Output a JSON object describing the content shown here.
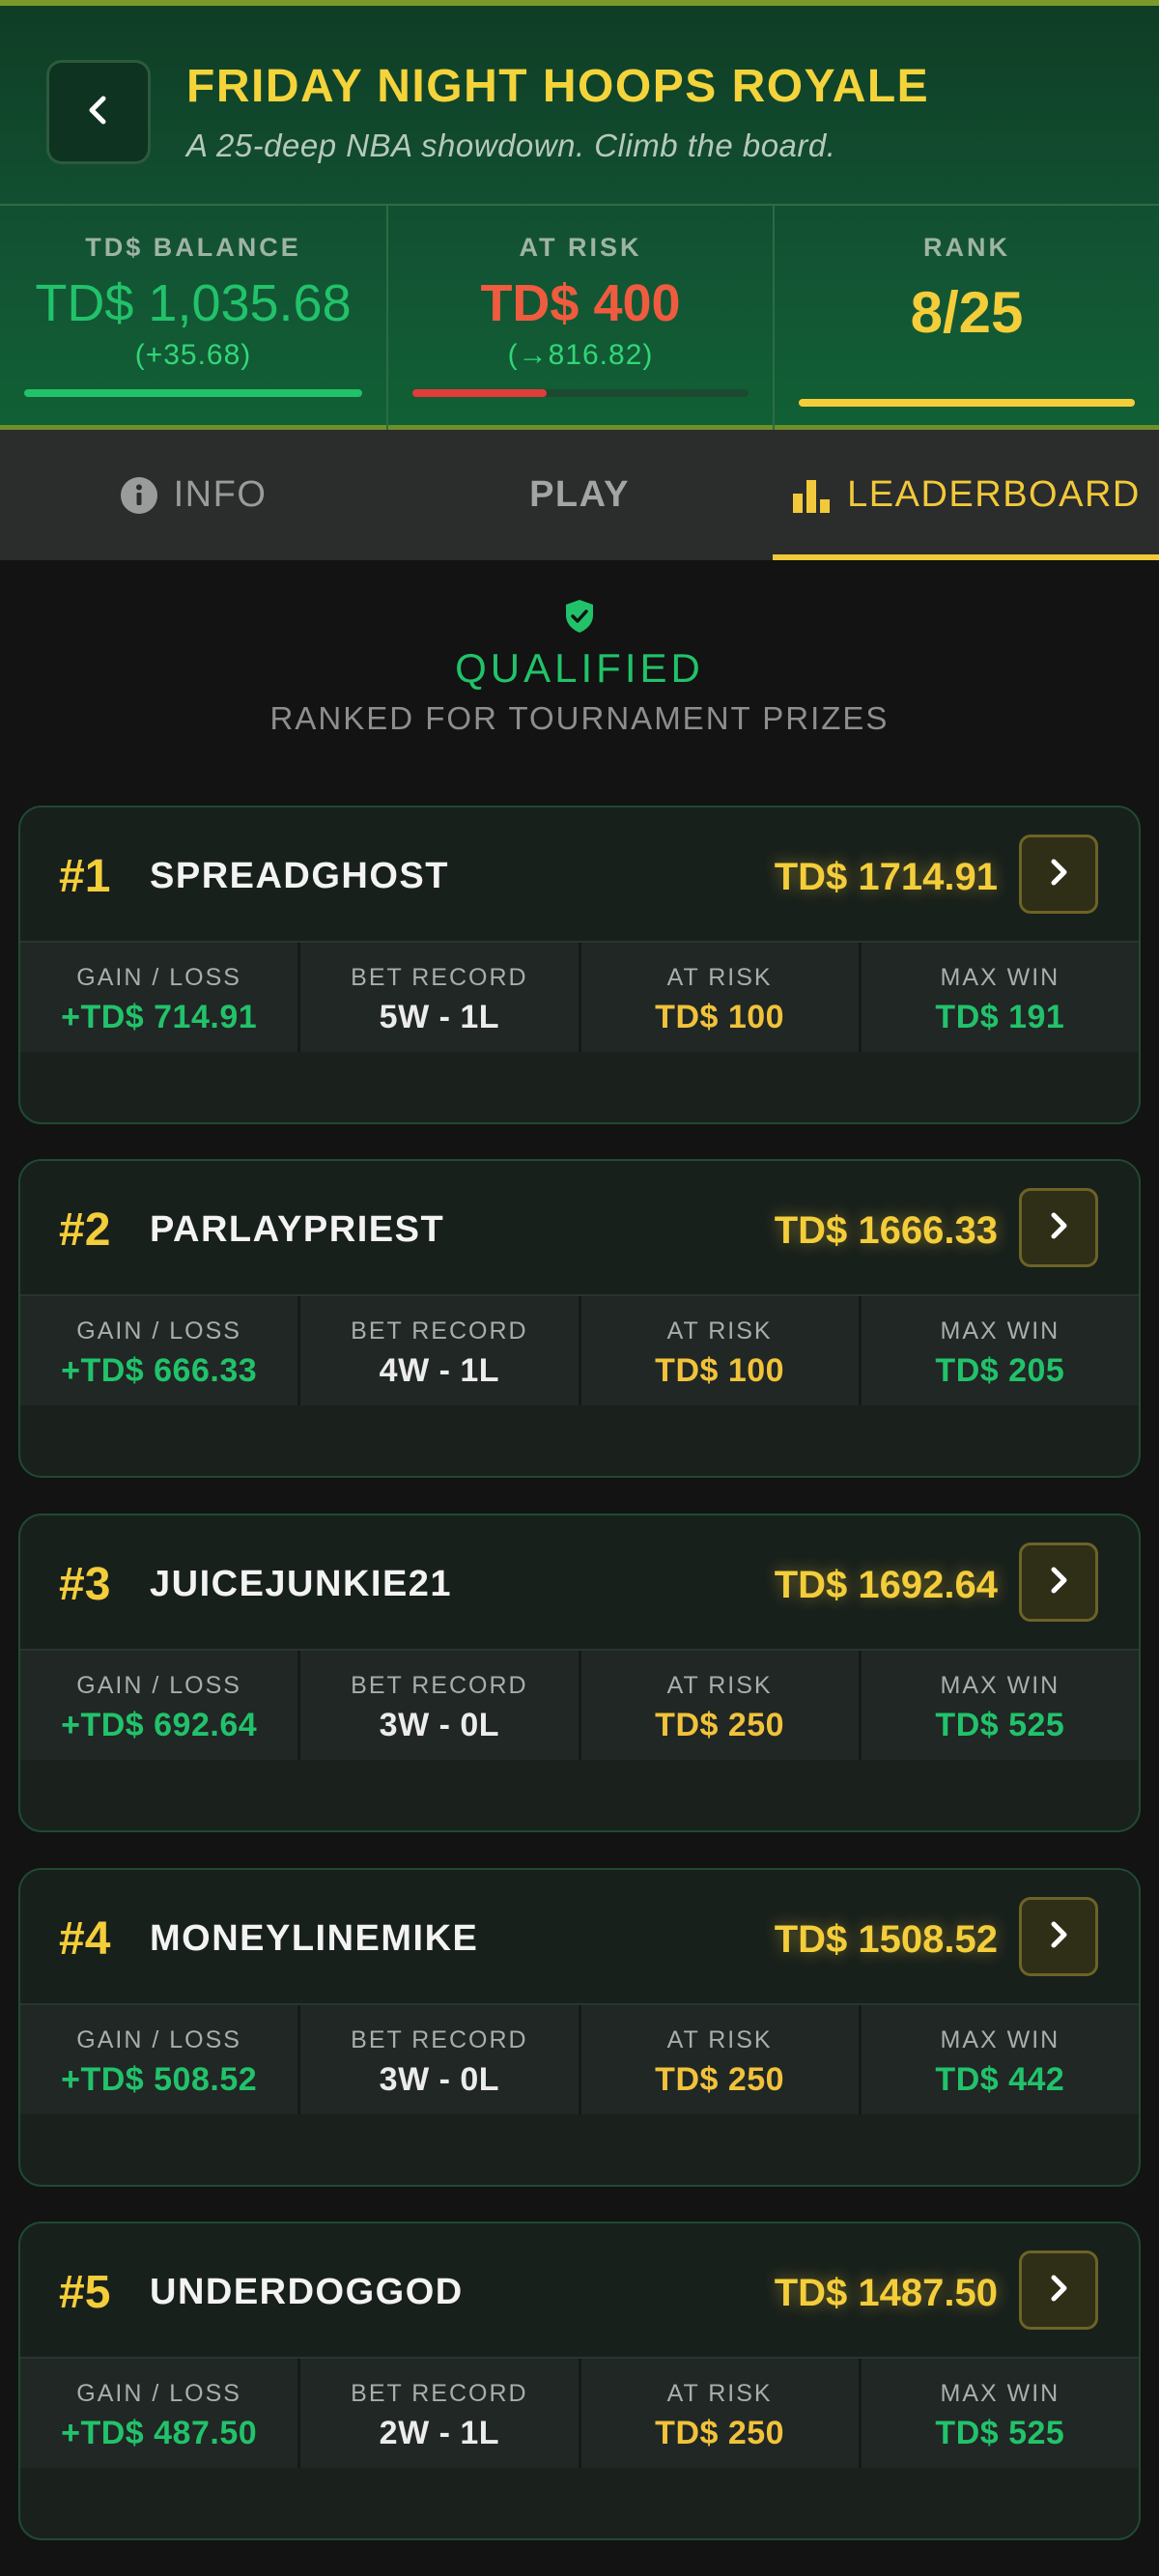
{
  "header": {
    "title": "FRIDAY NIGHT HOOPS ROYALE",
    "subtitle": "A 25-deep NBA showdown. Climb the board."
  },
  "stats": {
    "balance": {
      "label": "TD$ BALANCE",
      "value": "TD$ 1,035.68",
      "sub": "(+35.68)",
      "progress": 1.0,
      "color": "#22c26a"
    },
    "at_risk": {
      "label": "AT RISK",
      "value": "TD$ 400",
      "sub": "(→816.82)",
      "progress": 0.4,
      "color": "#e23b3b"
    },
    "rank": {
      "label": "RANK",
      "value": "8/25",
      "progress": 1.0,
      "color": "#f4cd3a"
    }
  },
  "tabs": [
    {
      "label": "INFO",
      "icon": "info-icon",
      "active": false
    },
    {
      "label": "PLAY",
      "active": false
    },
    {
      "label": "LEADERBOARD",
      "icon": "bar-chart-icon",
      "active": true
    }
  ],
  "qualified": {
    "icon": "shield-check-icon",
    "title": "QUALIFIED",
    "subtitle": "RANKED FOR TOURNAMENT PRIZES"
  },
  "stat_labels": {
    "gain": "GAIN / LOSS",
    "record": "BET RECORD",
    "risk": "AT RISK",
    "max": "MAX WIN"
  },
  "leaderboard": [
    {
      "rank": "#1",
      "name": "SPREADGHOST",
      "total": "TD$ 1714.91",
      "gain": "+TD$ 714.91",
      "record": "5W - 1L",
      "risk": "TD$ 100",
      "max": "TD$ 191"
    },
    {
      "rank": "#2",
      "name": "PARLAYPRIEST",
      "total": "TD$ 1666.33",
      "gain": "+TD$ 666.33",
      "record": "4W - 1L",
      "risk": "TD$ 100",
      "max": "TD$ 205"
    },
    {
      "rank": "#3",
      "name": "JUICEJUNKIE21",
      "total": "TD$ 1692.64",
      "gain": "+TD$ 692.64",
      "record": "3W - 0L",
      "risk": "TD$ 250",
      "max": "TD$ 525"
    },
    {
      "rank": "#4",
      "name": "MONEYLINEMIKE",
      "total": "TD$ 1508.52",
      "gain": "+TD$ 508.52",
      "record": "3W - 0L",
      "risk": "TD$ 250",
      "max": "TD$ 442"
    },
    {
      "rank": "#5",
      "name": "UNDERDOGGOD",
      "total": "TD$ 1487.50",
      "gain": "+TD$ 487.50",
      "record": "2W - 1L",
      "risk": "TD$ 250",
      "max": "TD$ 525"
    }
  ]
}
